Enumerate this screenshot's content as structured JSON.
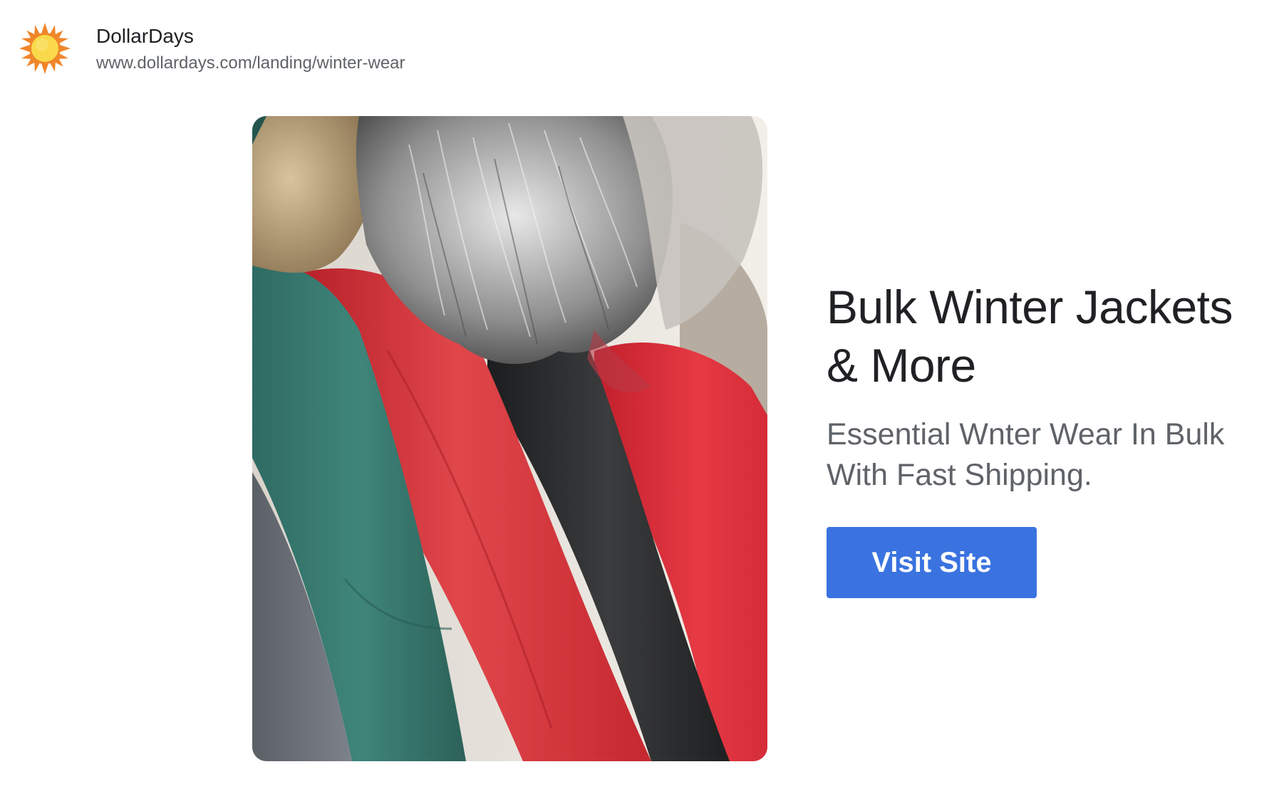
{
  "advertiser": {
    "name": "DollarDays",
    "url": "www.dollardays.com/landing/winter-wear",
    "logo_icon": "sun-icon"
  },
  "ad": {
    "image_subject": "winter-jackets-on-rack",
    "headline": "Bulk Winter Jackets & More",
    "description": "Essential Wnter Wear In Bulk With Fast Shipping.",
    "cta_label": "Visit Site"
  },
  "colors": {
    "cta_background": "#3a73e0",
    "headline_text": "#202124",
    "secondary_text": "#5f6368",
    "sun_core": "#f9d94a",
    "sun_rays": "#f0862a"
  }
}
